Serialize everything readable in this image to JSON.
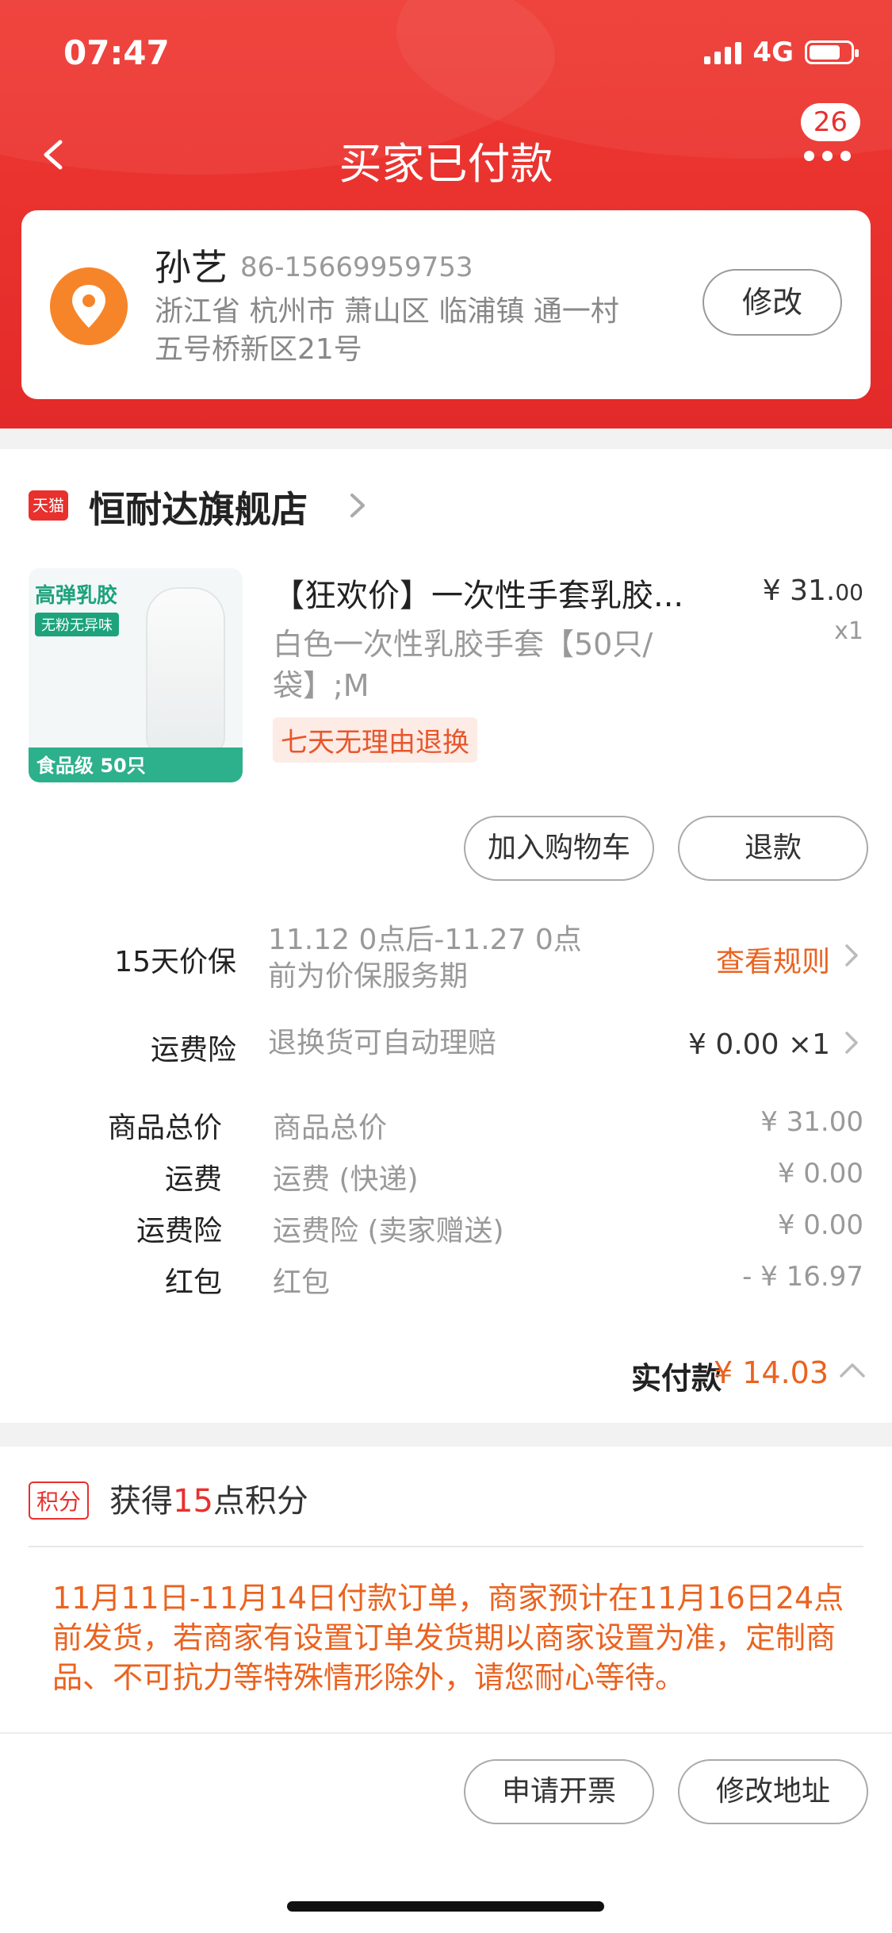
{
  "status_bar": {
    "time": "07:47",
    "network": "4G"
  },
  "nav": {
    "title": "买家已付款",
    "badge_count": "26"
  },
  "address": {
    "name": "孙艺",
    "phone": "86-15669959753",
    "line1": "浙江省 杭州市 萧山区 临浦镇 通一村",
    "line2": "五号桥新区21号",
    "edit_label": "修改"
  },
  "store": {
    "logo_text": "天猫",
    "name": "恒耐达旗舰店"
  },
  "item": {
    "thumb_title": "高弹乳胶",
    "thumb_sub": "无粉无异味",
    "thumb_bottom": "食品级 50只",
    "title": "【狂欢价】一次性手套乳胶...",
    "price_int": "¥ 31.",
    "price_dec": "00",
    "qty": "x1",
    "spec": "白色一次性乳胶手套【50只/袋】;M",
    "tag": "七天无理由退换",
    "btn_cart": "加入购物车",
    "btn_refund": "退款"
  },
  "services": {
    "price_protect_label": "15天价保",
    "price_protect_desc1": "11.12 0点后-11.27 0点",
    "price_protect_desc2": "前为价保服务期",
    "price_protect_link": "查看规则",
    "insurance_label": "运费险",
    "insurance_desc": "退换货可自动理赔",
    "insurance_value": "¥ 0.00 ×1"
  },
  "summary": {
    "rows": [
      {
        "label": "商品总价",
        "desc": "商品总价",
        "value": "¥ 31.00"
      },
      {
        "label": "运费",
        "desc": "运费 (快递)",
        "value": "¥ 0.00"
      },
      {
        "label": "运费险",
        "desc": "运费险 (卖家赠送)",
        "value": "¥ 0.00"
      },
      {
        "label": "红包",
        "desc": "红包",
        "value": "- ¥ 16.97"
      }
    ],
    "paid_label": "实付款",
    "paid_value": "¥ 14.03"
  },
  "points": {
    "tag": "积分",
    "prefix": "获得",
    "number": "15",
    "suffix": "点积分",
    "notice": "11月11日-11月14日付款订单，商家预计在11月16日24点前发货，若商家有设置订单发货期以商家设置为准，定制商品、不可抗力等特殊情形除外，请您耐心等待。"
  },
  "bottom": {
    "invoice_label": "申请开票",
    "change_addr_label": "修改地址"
  },
  "colors": {
    "brand_red": "#e8302d",
    "accent_orange": "#ea6320",
    "location_orange": "#f6852a"
  },
  "icons": [
    "back-icon",
    "more-icon",
    "location-pin-icon",
    "chevron-right-icon",
    "chevron-up-icon"
  ]
}
